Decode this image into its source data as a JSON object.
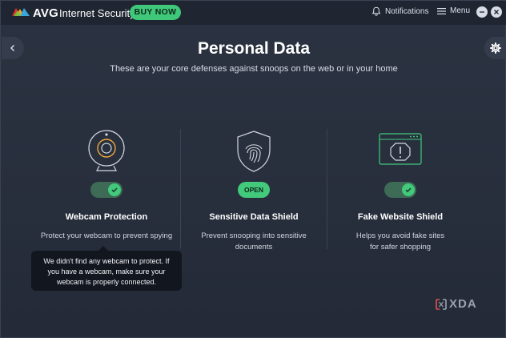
{
  "titlebar": {
    "brand": "AVG",
    "product": "Internet Security",
    "buy_now": "BUY NOW",
    "notifications": "Notifications",
    "menu": "Menu"
  },
  "page": {
    "title": "Personal Data",
    "subtitle": "These are your core defenses against snoops on the web or in your home"
  },
  "features": [
    {
      "name": "Webcam Protection",
      "description": "Protect your webcam to prevent spying",
      "control": "toggle",
      "state": "on"
    },
    {
      "name": "Sensitive Data Shield",
      "description": "Prevent snooping into sensitive documents",
      "control": "button",
      "button_label": "OPEN"
    },
    {
      "name": "Fake Website Shield",
      "description": "Helps you avoid fake sites for safer shopping",
      "control": "toggle",
      "state": "on"
    }
  ],
  "tooltip": {
    "text": "We didn't find any webcam to protect. If you have a webcam, make sure your webcam is properly connected."
  },
  "watermark": "XDA",
  "colors": {
    "accent_green": "#42c97b",
    "background": "#2a3140",
    "titlebar": "#1f2531"
  }
}
